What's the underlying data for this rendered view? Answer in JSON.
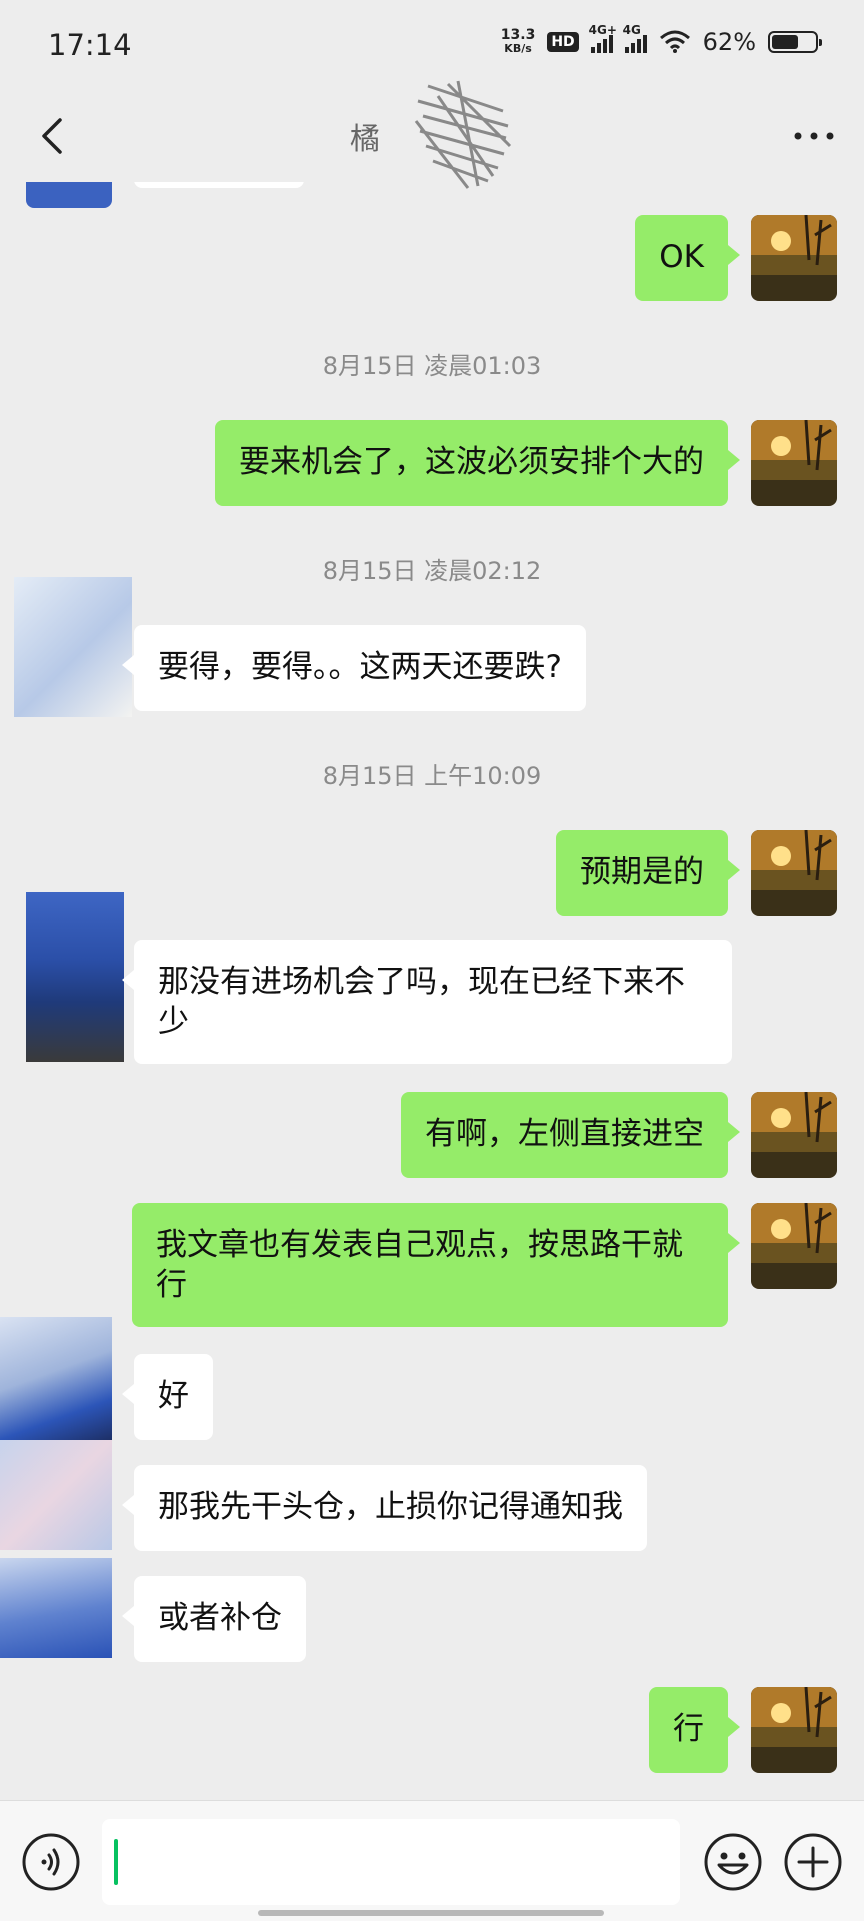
{
  "status_bar": {
    "time": "17:14",
    "net_speed_top": "13.3",
    "net_speed_unit": "KB/s",
    "hd_label": "HD",
    "signal1_label": "4G+",
    "signal2_label": "4G",
    "battery_percent": "62%",
    "battery_level": 0.62
  },
  "nav": {
    "title": "橘",
    "back_icon": "chevron-left-icon",
    "more_icon": "more-dots-icon"
  },
  "messages": [
    {
      "id": "m1",
      "sender": "me",
      "text": "OK"
    },
    {
      "id": "ts1",
      "type": "timestamp",
      "text": "8月15日 凌晨01:03"
    },
    {
      "id": "m2",
      "sender": "me",
      "text": "要来机会了，这波必须安排个大的"
    },
    {
      "id": "ts2",
      "type": "timestamp",
      "text": "8月15日 凌晨02:12"
    },
    {
      "id": "m3",
      "sender": "them",
      "text": "要得，要得。。这两天还要跌?"
    },
    {
      "id": "ts3",
      "type": "timestamp",
      "text": "8月15日 上午10:09"
    },
    {
      "id": "m4",
      "sender": "me",
      "text": "预期是的"
    },
    {
      "id": "m5",
      "sender": "them",
      "text": "那没有进场机会了吗，现在已经下来不少"
    },
    {
      "id": "m6",
      "sender": "me",
      "text": "有啊，左侧直接进空"
    },
    {
      "id": "m7",
      "sender": "me",
      "text": "我文章也有发表自己观点，按思路干就行"
    },
    {
      "id": "m8",
      "sender": "them",
      "text": "好"
    },
    {
      "id": "m9",
      "sender": "them",
      "text": "那我先干头仓，止损你记得通知我"
    },
    {
      "id": "m10",
      "sender": "them",
      "text": "或者补仓"
    },
    {
      "id": "m11",
      "sender": "me",
      "text": "行"
    }
  ],
  "input_bar": {
    "value": "",
    "voice_icon": "voice-icon",
    "emoji_icon": "emoji-icon",
    "plus_icon": "plus-circle-icon"
  },
  "colors": {
    "my_bubble": "#95ec69",
    "their_bubble": "#ffffff",
    "background": "#ededed",
    "cursor": "#07c160"
  }
}
